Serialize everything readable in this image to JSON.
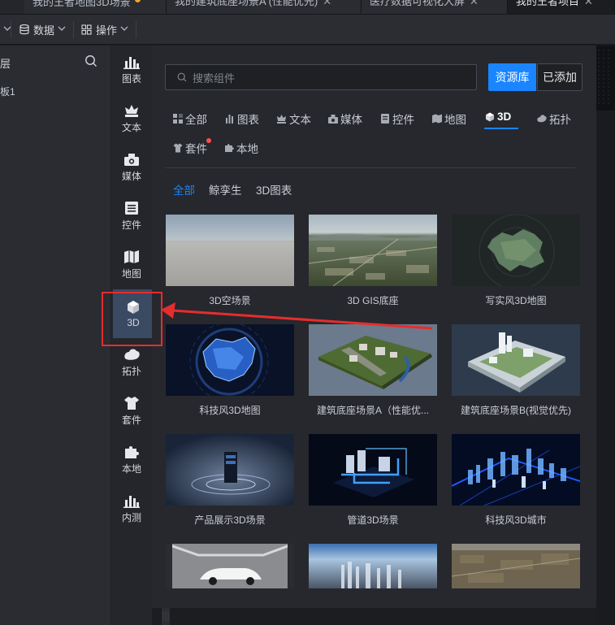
{
  "tabs": [
    {
      "label": "我的王者地图3D场景",
      "modified": true
    },
    {
      "label": "我的建筑底座场景A (性能优先)",
      "close": "✕"
    },
    {
      "label": "医疗数据可视化大屏",
      "close": "✕"
    },
    {
      "label": "我的王者项目",
      "close": "✕"
    }
  ],
  "toolbar": {
    "data_label": "数据",
    "ops_label": "操作"
  },
  "layers": {
    "title": "层",
    "row_label": "板1"
  },
  "rail": [
    {
      "label": "图表",
      "icon": "bar-chart-icon"
    },
    {
      "label": "文本",
      "icon": "text-crown-icon"
    },
    {
      "label": "媒体",
      "icon": "media-camera-icon"
    },
    {
      "label": "控件",
      "icon": "widget-list-icon"
    },
    {
      "label": "地图",
      "icon": "map-icon"
    },
    {
      "label": "3D",
      "icon": "cube-icon",
      "active": true
    },
    {
      "label": "拓扑",
      "icon": "topology-icon"
    },
    {
      "label": "套件",
      "icon": "kit-shirt-icon"
    },
    {
      "label": "本地",
      "icon": "puzzle-icon"
    },
    {
      "label": "内测",
      "icon": "beta-chart-icon"
    }
  ],
  "panel": {
    "search_placeholder": "搜索组件",
    "repo_label": "资源库",
    "added_label": "已添加",
    "accent": "#1a85ff",
    "categories": [
      {
        "label": "全部"
      },
      {
        "label": "图表"
      },
      {
        "label": "文本"
      },
      {
        "label": "媒体"
      },
      {
        "label": "控件"
      },
      {
        "label": "地图"
      },
      {
        "label": "3D",
        "active": true
      },
      {
        "label": "拓扑"
      },
      {
        "label": "套件",
        "badge": true
      },
      {
        "label": "本地"
      }
    ],
    "subcategories": [
      {
        "label": "全部",
        "active": true
      },
      {
        "label": "鲸孪生"
      },
      {
        "label": "3D图表"
      }
    ],
    "cards": [
      {
        "label": "3D空场景"
      },
      {
        "label": "3D GIS底座"
      },
      {
        "label": "写实风3D地图"
      },
      {
        "label": "科技风3D地图"
      },
      {
        "label": "建筑底座场景A（性能优..."
      },
      {
        "label": "建筑底座场景B(视觉优先)"
      },
      {
        "label": "产品展示3D场景"
      },
      {
        "label": "管道3D场景"
      },
      {
        "label": "科技风3D城市"
      }
    ]
  }
}
